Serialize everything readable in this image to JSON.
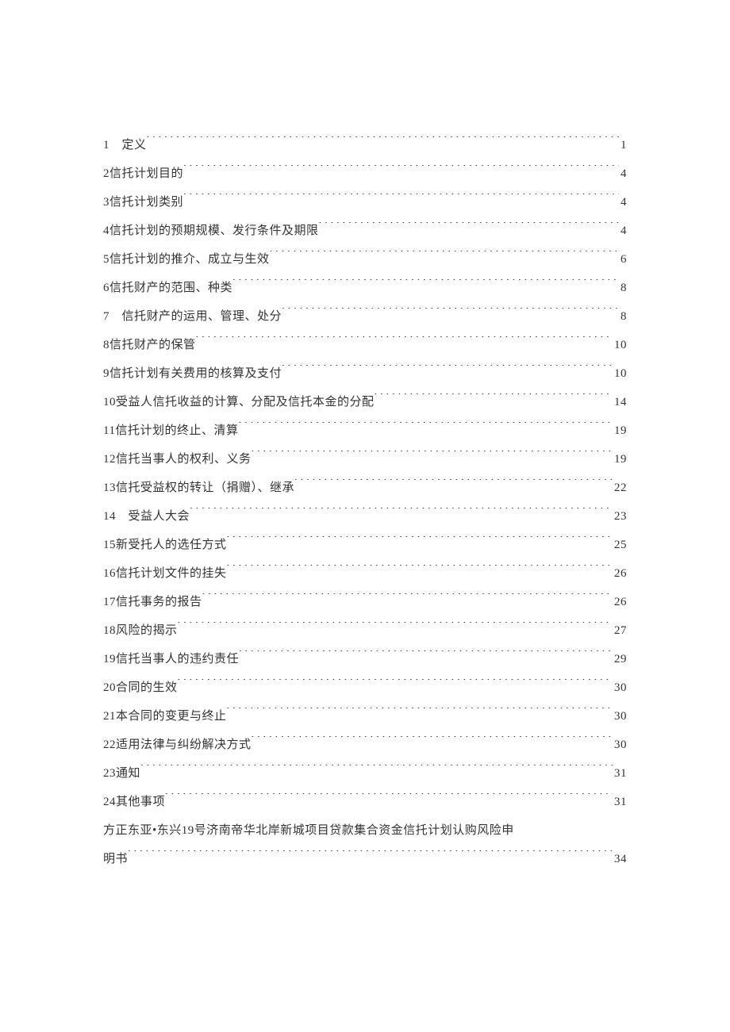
{
  "toc": [
    {
      "num": "1",
      "title": "　定义",
      "page": "1"
    },
    {
      "num": "2",
      "title": "信托计划目的",
      "page": "4"
    },
    {
      "num": "3",
      "title": "信托计划类别",
      "page": "4"
    },
    {
      "num": "4",
      "title": "信托计划的预期规模、发行条件及期限",
      "page": "4"
    },
    {
      "num": "5",
      "title": "信托计划的推介、成立与生效",
      "page": "6"
    },
    {
      "num": "6",
      "title": "信托财产的范围、种类",
      "page": "8"
    },
    {
      "num": "7",
      "title": "　信托财产的运用、管理、处分",
      "page": "8"
    },
    {
      "num": "8",
      "title": "信托财产的保管",
      "page": "10"
    },
    {
      "num": "9",
      "title": "信托计划有关费用的核算及支付",
      "page": "10"
    },
    {
      "num": "10",
      "title": "受益人信托收益的计算、分配及信托本金的分配",
      "page": "14"
    },
    {
      "num": "11",
      "title": "信托计划的终止、清算",
      "page": "19"
    },
    {
      "num": "12",
      "title": "信托当事人的权利、义务",
      "page": "19"
    },
    {
      "num": "13",
      "title": "信托受益权的转让（捐赠）、继承",
      "page": "22"
    },
    {
      "num": "14",
      "title": "　受益人大会",
      "page": "23"
    },
    {
      "num": "15",
      "title": "新受托人的选任方式",
      "page": "25"
    },
    {
      "num": "16",
      "title": "信托计划文件的挂失",
      "page": "26"
    },
    {
      "num": "17",
      "title": "信托事务的报告",
      "page": "26"
    },
    {
      "num": "18",
      "title": "风险的揭示",
      "page": "27"
    },
    {
      "num": "19",
      "title": "信托当事人的违约责任",
      "page": "29"
    },
    {
      "num": "20",
      "title": "合同的生效",
      "page": "30"
    },
    {
      "num": "21",
      "title": "本合同的变更与终止",
      "page": "30"
    },
    {
      "num": "22",
      "title": "适用法律与纠纷解决方式",
      "page": "30"
    },
    {
      "num": "23",
      "title": "通知",
      "page": "31"
    },
    {
      "num": "24",
      "title": "其他事项",
      "page": "31"
    }
  ],
  "appendix": {
    "line1": "方正东亚•东兴19号济南帝华北岸新城项目贷款集合资金信托计划认购风险申",
    "line2_title": "明书",
    "line2_page": "34"
  }
}
